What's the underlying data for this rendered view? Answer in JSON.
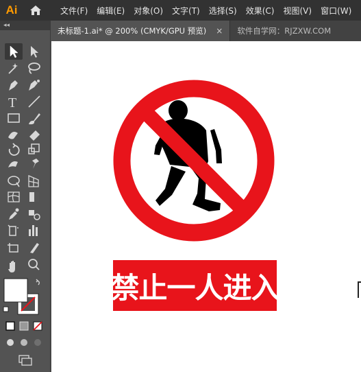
{
  "app": {
    "logo": "Ai",
    "menus": [
      "文件(F)",
      "编辑(E)",
      "对象(O)",
      "文字(T)",
      "选择(S)",
      "效果(C)",
      "视图(V)",
      "窗口(W)"
    ]
  },
  "tabs": {
    "active": "未标题-1.ai* @ 200% (CMYK/GPU 预览)",
    "close": "×",
    "inactive": "软件自学网：RJZXW.COM"
  },
  "toolbar": {
    "collapse": "◂◂",
    "tools": [
      "selection-tool",
      "direct-selection-tool",
      "magic-wand-tool",
      "lasso-tool",
      "pen-tool",
      "curvature-tool",
      "type-tool",
      "line-tool",
      "rectangle-tool",
      "paintbrush-tool",
      "shaper-tool",
      "eraser-tool",
      "rotate-tool",
      "scale-tool",
      "width-tool",
      "puppet-warp-tool",
      "shape-builder-tool",
      "perspective-grid-tool",
      "mesh-tool",
      "gradient-tool",
      "eyedropper-tool",
      "blend-tool",
      "symbol-sprayer-tool",
      "column-graph-tool",
      "artboard-tool",
      "slice-tool",
      "hand-tool",
      "zoom-tool"
    ]
  },
  "artwork": {
    "sign_text": "禁止一人进入",
    "colors": {
      "red": "#e8141b",
      "black": "#000000",
      "white": "#ffffff"
    }
  }
}
